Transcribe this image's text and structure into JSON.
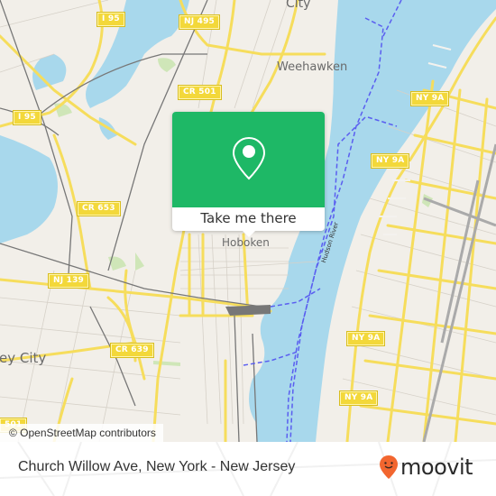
{
  "map": {
    "place_labels": [
      {
        "id": "city",
        "text": "City"
      },
      {
        "id": "weehawken",
        "text": "Weehawken"
      },
      {
        "id": "hoboken",
        "text": "Hoboken"
      },
      {
        "id": "jersey-city",
        "text": "ey City"
      }
    ],
    "road_shields": [
      {
        "id": "i95-top",
        "text": "I 95"
      },
      {
        "id": "nj495",
        "text": "NJ 495"
      },
      {
        "id": "cr501-top",
        "text": "CR 501"
      },
      {
        "id": "i95-left",
        "text": "I 95"
      },
      {
        "id": "ny9a-1",
        "text": "NY 9A"
      },
      {
        "id": "ny9a-2",
        "text": "NY 9A"
      },
      {
        "id": "cr653",
        "text": "CR 653"
      },
      {
        "id": "nj139",
        "text": "NJ 139"
      },
      {
        "id": "cr639",
        "text": "CR 639"
      },
      {
        "id": "ny9a-3",
        "text": "NY 9A"
      },
      {
        "id": "ny9a-4",
        "text": "NY 9A"
      },
      {
        "id": "cr501-bottom",
        "text": "501"
      }
    ],
    "river_label": "Hudson River",
    "attribution": "© OpenStreetMap contributors",
    "colors": {
      "land": "#f2efe9",
      "water": "#a8d8ec",
      "road_major": "#f6dd5c",
      "road_minor": "#c9c4bc",
      "rail": "#777777",
      "ferry": "#5a5ef0",
      "park": "#cfe6b8"
    }
  },
  "popup": {
    "icon": "map-pin-icon",
    "button_label": "Take me there",
    "color": "#1eb866"
  },
  "footer": {
    "title": "Church Willow Ave, New York - New Jersey",
    "brand": "moovit",
    "brand_color": "#f2662f"
  }
}
